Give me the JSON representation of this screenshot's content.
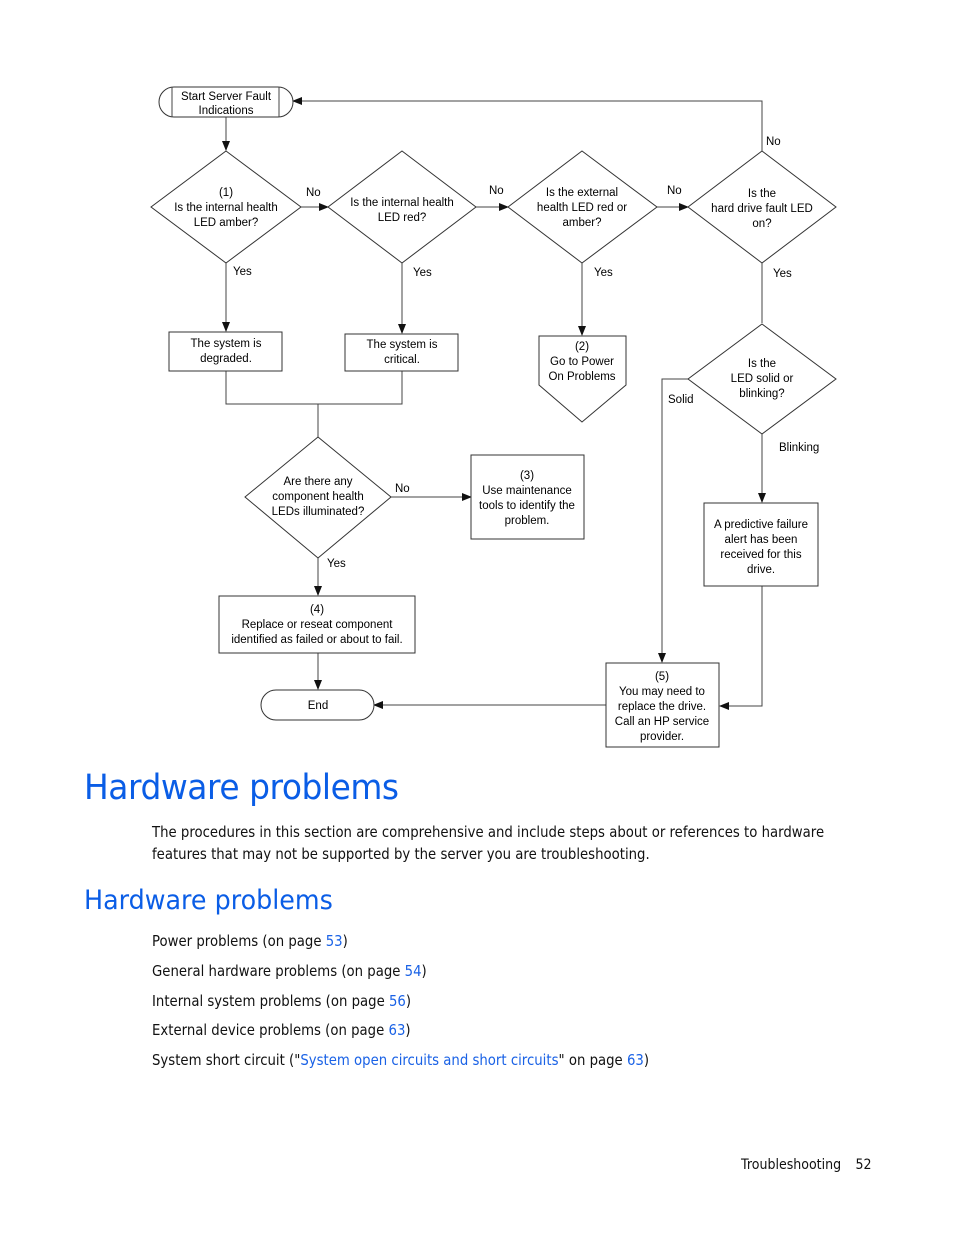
{
  "flowchart": {
    "start": [
      "Start Server Fault",
      "Indications"
    ],
    "d1": [
      "(1)",
      "Is the internal health",
      "LED amber?"
    ],
    "d2": [
      "Is the internal health",
      "LED red?"
    ],
    "d3": [
      "Is the external",
      "health LED red or",
      "amber?"
    ],
    "d4": [
      "Is the",
      "hard drive fault LED",
      "on?"
    ],
    "d5": [
      "Is the",
      "LED solid or",
      "blinking?"
    ],
    "d6": [
      "Are there any",
      "component health",
      "LEDs illuminated?"
    ],
    "box_degraded": [
      "The system is",
      "degraded."
    ],
    "box_critical": [
      "The system is",
      "critical."
    ],
    "offpage_power": [
      "(2)",
      "Go to Power",
      "On Problems"
    ],
    "box_maintenance": [
      "(3)",
      "Use maintenance",
      "tools to identify the",
      "problem."
    ],
    "box_replace": [
      "(4)",
      "Replace or reseat component",
      "identified as failed or about to fail."
    ],
    "box_predictive": [
      "A predictive failure",
      "alert has been",
      "received for this",
      "drive."
    ],
    "box_drive": [
      "(5)",
      "You may need to",
      "replace the drive.",
      "Call an HP service",
      "provider."
    ],
    "end": "End",
    "labels": {
      "yes": "Yes",
      "no": "No",
      "solid": "Solid",
      "blinking": "Blinking"
    }
  },
  "section": {
    "title": "Hardware problems",
    "intro": "The procedures in this section are comprehensive and include steps about or references to hardware features that may not be supported by the server you are troubleshooting."
  },
  "subsection": {
    "title": "Hardware problems",
    "links": [
      {
        "prefix": "Power problems (on page ",
        "link": "",
        "mid": "",
        "page": "53",
        "suffix": ")"
      },
      {
        "prefix": "General hardware problems (on page ",
        "link": "",
        "mid": "",
        "page": "54",
        "suffix": ")"
      },
      {
        "prefix": "Internal system problems (on page ",
        "link": "",
        "mid": "",
        "page": "56",
        "suffix": ")"
      },
      {
        "prefix": "External device problems (on page ",
        "link": "",
        "mid": "",
        "page": "63",
        "suffix": ")"
      },
      {
        "prefix": "System short circuit (\"",
        "link": "System open circuits and short circuits",
        "mid": "\" on page ",
        "page": "63",
        "suffix": ")"
      }
    ]
  },
  "footer": {
    "section": "Troubleshooting",
    "page": "52"
  },
  "colors": {
    "heading": "#0a5de6",
    "link": "#1a62e6"
  }
}
